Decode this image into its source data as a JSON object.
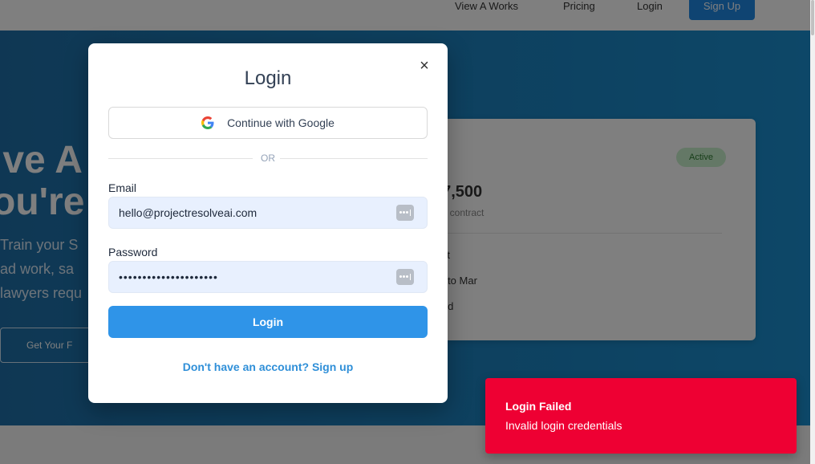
{
  "background": {
    "nav": {
      "links": [
        "View A Works",
        "Pricing",
        "Login"
      ],
      "signup_label": "Sign Up"
    },
    "hero": {
      "title": "lve A\nou're",
      "subtitle": "Train your S\nad work, sa\nlawyers requ",
      "cta_label": "Get Your F"
    },
    "card": {
      "badge": "Active",
      "price": "$7,500",
      "price_note": "per contract",
      "features": [
        "ient",
        "ntato Mar",
        "ated"
      ]
    }
  },
  "modal": {
    "title": "Login",
    "close_glyph": "×",
    "google_label": "Continue with Google",
    "divider_text": "OR",
    "email": {
      "label": "Email",
      "value": "hello@projectresolveai.com"
    },
    "password": {
      "label": "Password",
      "value": "•••••••••••••••••••••"
    },
    "submit_label": "Login",
    "signup_link": "Don't have an account? Sign up"
  },
  "toast": {
    "title": "Login Failed",
    "description": "Invalid login credentials",
    "color": "#ee0033"
  },
  "colors": {
    "primary": "#2f94e8",
    "link": "#2f8fd8",
    "input_bg": "#e8f0fe",
    "overlay": "rgba(0,0,0,0.5)"
  },
  "icons": [
    "close-icon",
    "google-icon",
    "password-manager-icon"
  ]
}
